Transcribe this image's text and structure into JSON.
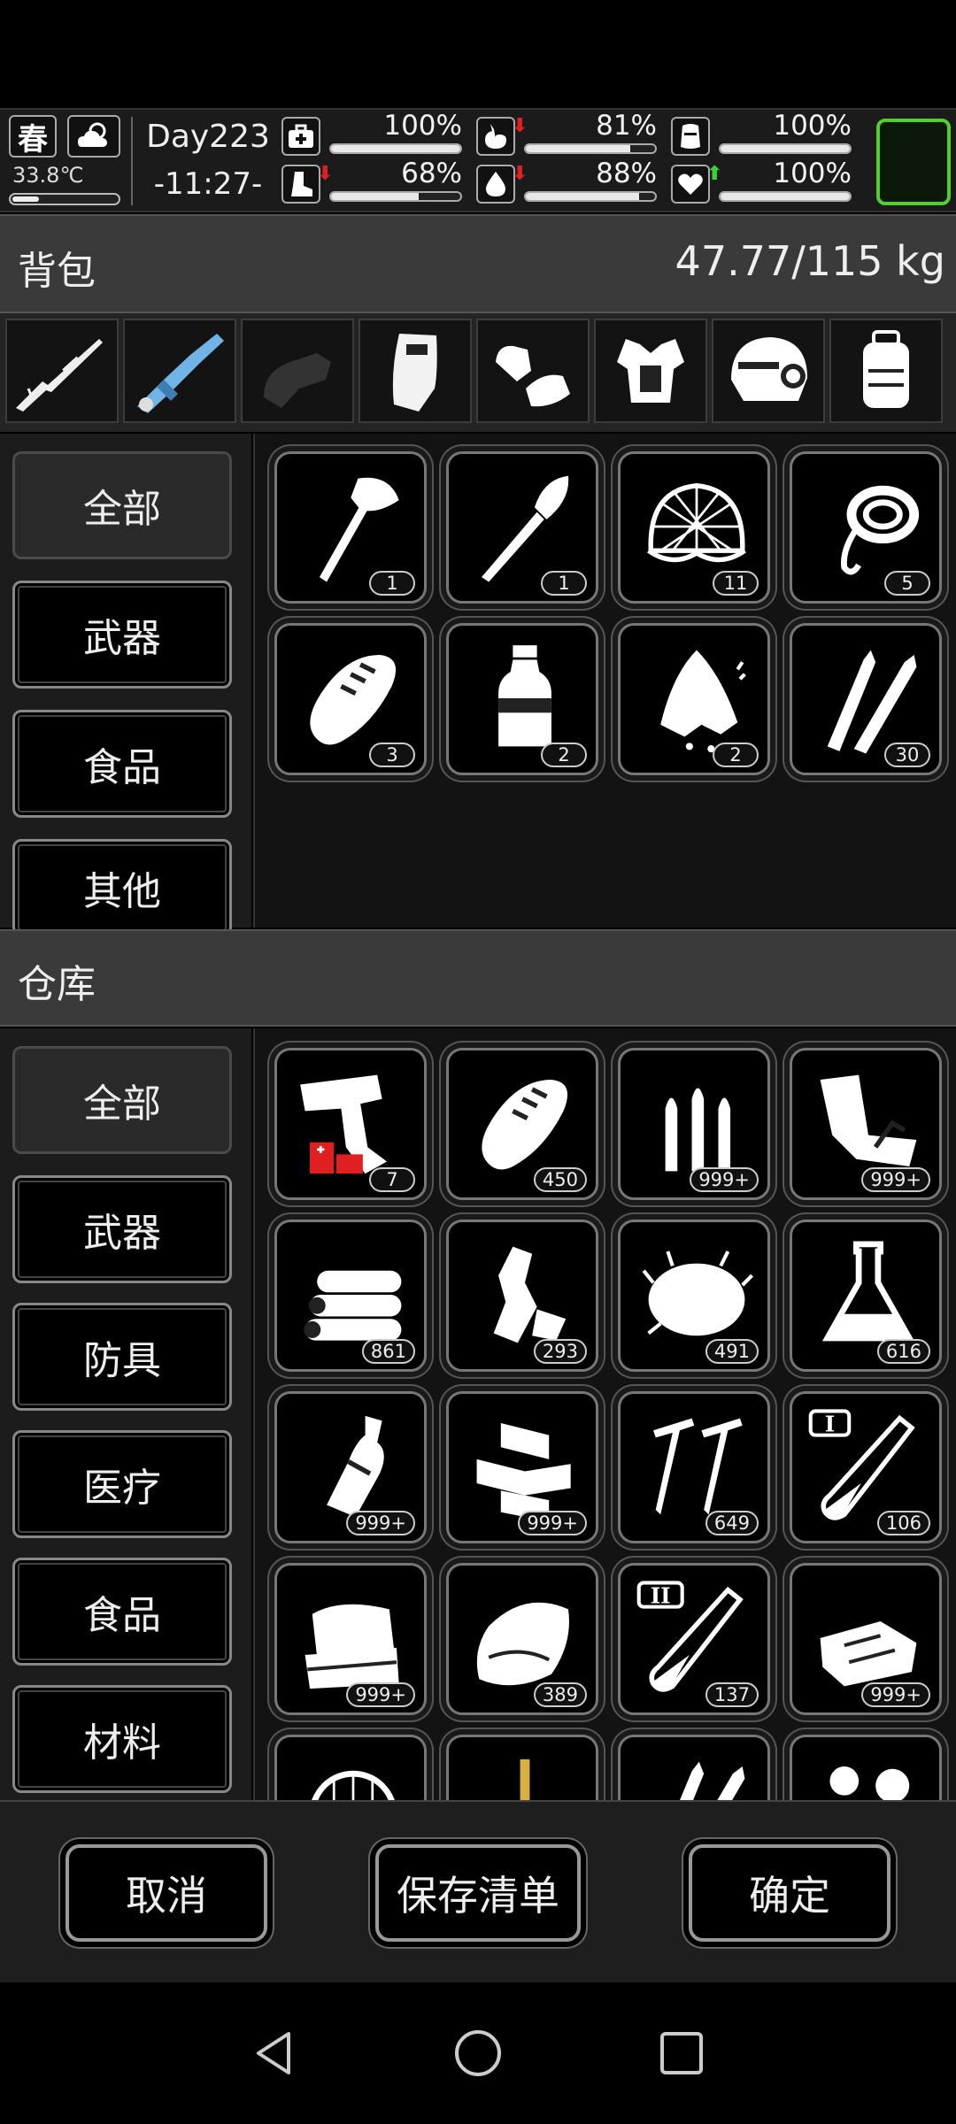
{
  "hud": {
    "season": "春",
    "weather_icon": "partly-cloudy-icon",
    "temperature": "33.8℃",
    "day": "Day223",
    "time": "-11:27-",
    "stats": [
      {
        "name": "health",
        "icon": "medkit-icon",
        "pct_text": "100%",
        "level": 1.0,
        "trend": ""
      },
      {
        "name": "hunger",
        "icon": "stomach-icon",
        "pct_text": "81%",
        "level": 0.81,
        "trend": "down"
      },
      {
        "name": "armor",
        "icon": "armor-icon",
        "pct_text": "100%",
        "level": 1.0,
        "trend": ""
      },
      {
        "name": "stamina",
        "icon": "boot-icon",
        "pct_text": "68%",
        "level": 0.68,
        "trend": "down"
      },
      {
        "name": "thirst",
        "icon": "water-drop-icon",
        "pct_text": "88%",
        "level": 0.88,
        "trend": "down"
      },
      {
        "name": "mood",
        "icon": "heart-icon",
        "pct_text": "100%",
        "level": 1.0,
        "trend": "up"
      }
    ],
    "colors": {
      "trend_down": "#e02020",
      "trend_up": "#3ccf3c",
      "active_frame": "#55cc33"
    }
  },
  "backpack": {
    "title": "背包",
    "weight": "47.77/115 kg",
    "equipment": [
      "sniper-rifle-icon",
      "minigun-icon",
      "gloves-empty-icon",
      "riot-shield-icon",
      "gloves-icon",
      "vest-icon",
      "helmet-icon",
      "backpack-icon"
    ],
    "categories": [
      "全部",
      "武器",
      "食品",
      "其他"
    ],
    "items": [
      {
        "icon": "axe-icon",
        "qty": "1"
      },
      {
        "icon": "shovel-icon",
        "qty": "1"
      },
      {
        "icon": "net-icon",
        "qty": "11"
      },
      {
        "icon": "rope-icon",
        "qty": "5"
      },
      {
        "icon": "bread-icon",
        "qty": "3"
      },
      {
        "icon": "water-bottle-icon",
        "qty": "2"
      },
      {
        "icon": "raw-meat-icon",
        "qty": "2"
      },
      {
        "icon": "rifle-ammo-icon",
        "qty": "30"
      }
    ]
  },
  "storage": {
    "title": "仓库",
    "categories": [
      "全部",
      "武器",
      "防具",
      "医疗",
      "食品",
      "材料"
    ],
    "items": [
      {
        "icon": "flare-gun-icon",
        "qty": "7"
      },
      {
        "icon": "bread-icon",
        "qty": "450"
      },
      {
        "icon": "bullets-icon",
        "qty": "999+"
      },
      {
        "icon": "scrap-cloth-icon",
        "qty": "999+"
      },
      {
        "icon": "logs-icon",
        "qty": "861"
      },
      {
        "icon": "plastic-trash-icon",
        "qty": "293"
      },
      {
        "icon": "fiber-icon",
        "qty": "491"
      },
      {
        "icon": "flask-icon",
        "qty": "616"
      },
      {
        "icon": "glass-bottle-icon",
        "qty": "999+"
      },
      {
        "icon": "bricks-icon",
        "qty": "999+"
      },
      {
        "icon": "nails-icon",
        "qty": "649"
      },
      {
        "icon": "test-tube-i-icon",
        "qty": "106"
      },
      {
        "icon": "towels-icon",
        "qty": "999+"
      },
      {
        "icon": "cloth-icon",
        "qty": "389"
      },
      {
        "icon": "test-tube-ii-icon",
        "qty": "137"
      },
      {
        "icon": "fabric-icon",
        "qty": "999+"
      },
      {
        "icon": "sieve-icon",
        "qty": ""
      },
      {
        "icon": "stick-icon",
        "qty": ""
      },
      {
        "icon": "ammo-icon",
        "qty": ""
      },
      {
        "icon": "balls-icon",
        "qty": ""
      }
    ]
  },
  "actions": {
    "cancel": "取消",
    "save_list": "保存清单",
    "confirm": "确定"
  },
  "nav": [
    "back-icon",
    "home-icon",
    "recents-icon"
  ]
}
